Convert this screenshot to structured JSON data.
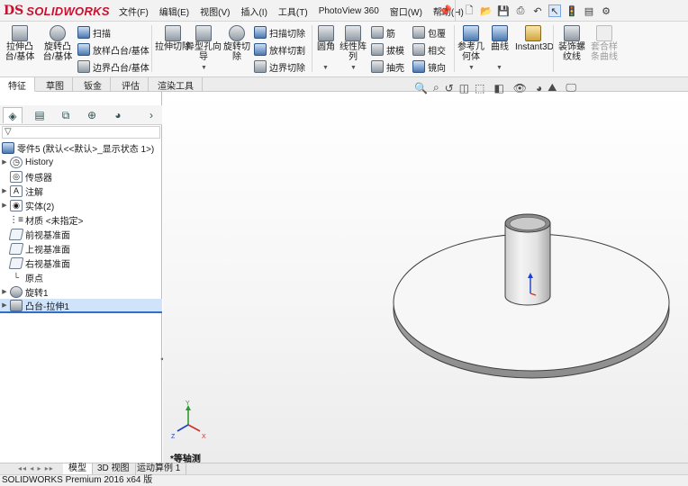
{
  "app": {
    "brand_ds": "DS",
    "brand_name": "SOLIDWORKS"
  },
  "menu": [
    "文件(F)",
    "编辑(E)",
    "视图(V)",
    "插入(I)",
    "工具(T)",
    "PhotoView 360",
    "窗口(W)",
    "帮助(H)"
  ],
  "quick_access": {
    "icons": [
      "new-icon",
      "open-icon",
      "save-icon",
      "print-icon",
      "undo-icon",
      "select-icon",
      "rebuild-icon",
      "file-properties-icon",
      "options-icon"
    ]
  },
  "commands": {
    "extruded_boss": "拉伸凸台/基体",
    "revolved_boss": "旋转凸台/基体",
    "swept_boss": "扫描",
    "lofted_boss": "放样凸台/基体",
    "boundary_boss": "边界凸台/基体",
    "extruded_cut": "拉伸切除",
    "hole_wizard": "异型孔向导",
    "revolved_cut": "旋转切除",
    "swept_cut": "扫描切除",
    "lofted_cut": "放样切割",
    "boundary_cut": "边界切除",
    "fillet": "圆角",
    "linear_pattern": "线性阵列",
    "rib": "筋",
    "draft": "拔模",
    "shell": "抽壳",
    "wrap": "包覆",
    "intersect": "相交",
    "mirror": "镜向",
    "reference_geometry": "参考几何体",
    "curves": "曲线",
    "instant3d": "Instant3D",
    "cosmetic_thread": "装饰螺纹线",
    "combine_curves": "套合样条曲线"
  },
  "tabs": [
    "特征",
    "草图",
    "钣金",
    "评估",
    "渲染工具"
  ],
  "tree": {
    "filter_icon": "funnel-icon",
    "root": "零件5 (默认<<默认>_显示状态 1>)",
    "items": [
      {
        "label": "History",
        "icon": "history-icon",
        "expandable": true
      },
      {
        "label": "传感器",
        "icon": "sensor-icon",
        "expandable": false
      },
      {
        "label": "注解",
        "icon": "annotation-icon",
        "expandable": true
      },
      {
        "label": "实体(2)",
        "icon": "solid-bodies-icon",
        "expandable": true
      },
      {
        "label": "材质 <未指定>",
        "icon": "material-icon",
        "expandable": false
      },
      {
        "label": "前视基准面",
        "icon": "plane-icon",
        "expandable": false
      },
      {
        "label": "上视基准面",
        "icon": "plane-icon",
        "expandable": false
      },
      {
        "label": "右视基准面",
        "icon": "plane-icon",
        "expandable": false
      },
      {
        "label": "原点",
        "icon": "origin-icon",
        "expandable": false
      },
      {
        "label": "旋转1",
        "icon": "revolve-feature-icon",
        "expandable": true
      },
      {
        "label": "凸台-拉伸1",
        "icon": "extrude-feature-icon",
        "expandable": true,
        "selected": true
      }
    ]
  },
  "viewport": {
    "view_name": "*等轴测",
    "axis_labels": [
      "Y",
      "Z",
      "X"
    ]
  },
  "bottom_tabs": [
    "模型",
    "3D 视图",
    "运动算例 1"
  ],
  "status": "SOLIDWORKS Premium 2016 x64 版",
  "colors": {
    "brand": "#c8102e",
    "selection": "#cfe3fb",
    "accent": "#2e6fc7"
  }
}
